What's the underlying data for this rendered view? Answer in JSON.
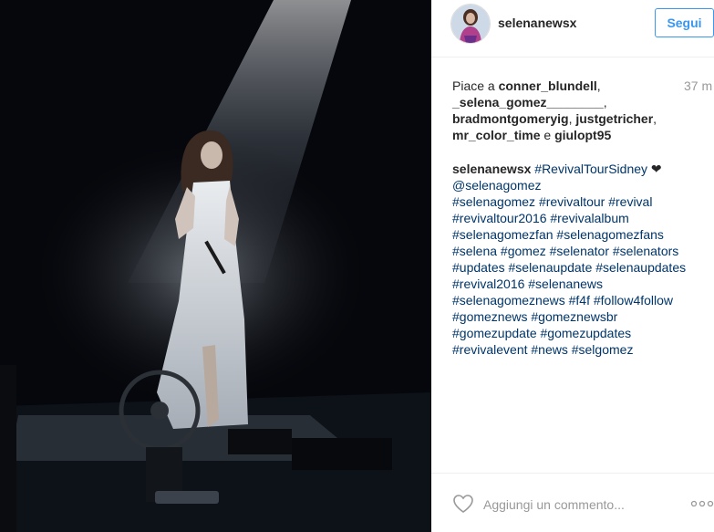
{
  "header": {
    "username": "selenanewsx",
    "follow_label": "Segui"
  },
  "likes": {
    "prefix": "Piace a",
    "users": [
      "conner_blundell",
      "_selena_gomez________",
      "bradmontgomeryig",
      "justgetricher",
      "mr_color_time",
      "giulopt95"
    ],
    "separators": [
      ", ",
      ", ",
      ", ",
      ", ",
      " e "
    ],
    "time": "37 m"
  },
  "caption": {
    "username": "selenanewsx",
    "lines": [
      "#RevivalTourSidney",
      "@selenagomez",
      "#selenagomez #revivaltour #revival",
      "#revivaltour2016 #revivalalbum",
      "#selenagomezfan #selenagomezfans",
      "#selena #gomez #selenator #selenators",
      "#updates #selenaupdate #selenaupdates",
      "#revival2016 #selenanews",
      "#selenagomeznews #f4f #follow4follow",
      "#gomeznews #gomeznewsbr",
      "#gomezupdate #gomezupdates",
      "#revivalevent #news #selgomez"
    ],
    "heart_glyph": "❤"
  },
  "footer": {
    "comment_placeholder": "Aggiungi un commento..."
  },
  "icons": {
    "photo": "concert-photo",
    "avatar": "avatar-image",
    "like": "heart-outline-icon",
    "more": "more-dots-icon"
  },
  "colors": {
    "accent": "#3897f0",
    "link": "#003569",
    "muted": "#999999",
    "text": "#262626"
  }
}
